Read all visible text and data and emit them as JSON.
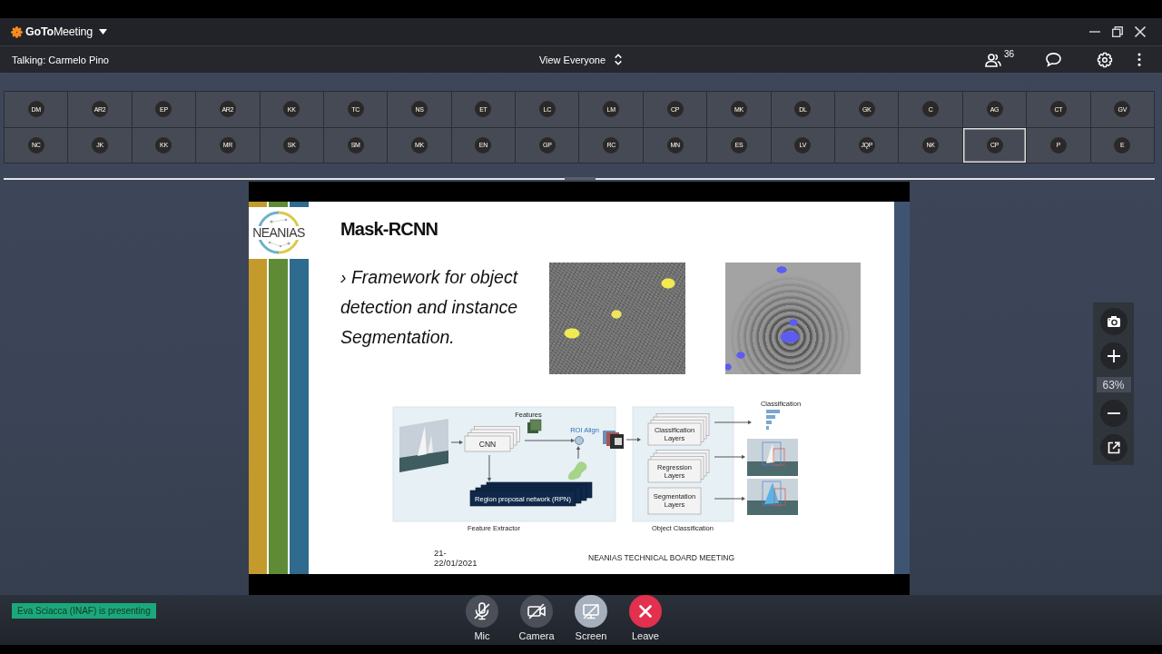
{
  "app": {
    "logo": "**GoTo**Meeting"
  },
  "meeting_bar": {
    "talking": "Talking: Carmelo Pino",
    "view": "View Everyone",
    "participant_count": "36"
  },
  "participants": [
    {
      "initials": "DM",
      "selected": false
    },
    {
      "initials": "AR2",
      "selected": false
    },
    {
      "initials": "EP",
      "selected": false
    },
    {
      "initials": "AR2",
      "selected": false
    },
    {
      "initials": "KK",
      "selected": false
    },
    {
      "initials": "TC",
      "selected": false
    },
    {
      "initials": "NS",
      "selected": false
    },
    {
      "initials": "ET",
      "selected": false
    },
    {
      "initials": "LC",
      "selected": false
    },
    {
      "initials": "LM",
      "selected": false
    },
    {
      "initials": "CP",
      "selected": false
    },
    {
      "initials": "MK",
      "selected": false
    },
    {
      "initials": "DL",
      "selected": false
    },
    {
      "initials": "GK",
      "selected": false
    },
    {
      "initials": "C",
      "selected": false
    },
    {
      "initials": "AG",
      "selected": false
    },
    {
      "initials": "CT",
      "selected": false
    },
    {
      "initials": "GV",
      "selected": false
    },
    {
      "initials": "NC",
      "selected": false
    },
    {
      "initials": "JK",
      "selected": false
    },
    {
      "initials": "KK",
      "selected": false
    },
    {
      "initials": "MR",
      "selected": false
    },
    {
      "initials": "SK",
      "selected": false
    },
    {
      "initials": "SM",
      "selected": false
    },
    {
      "initials": "MK",
      "selected": false
    },
    {
      "initials": "EN",
      "selected": false
    },
    {
      "initials": "GP",
      "selected": false
    },
    {
      "initials": "RC",
      "selected": false
    },
    {
      "initials": "MN",
      "selected": false
    },
    {
      "initials": "ES",
      "selected": false
    },
    {
      "initials": "LV",
      "selected": false
    },
    {
      "initials": "JQP",
      "selected": false
    },
    {
      "initials": "NK",
      "selected": false
    },
    {
      "initials": "CP",
      "selected": true
    },
    {
      "initials": "P",
      "selected": false
    },
    {
      "initials": "E",
      "selected": false
    }
  ],
  "slide": {
    "logo_text": "NEANIAS",
    "title": "Mask-RCNN",
    "bullet": "› Framework for object detection and instance Segmentation.",
    "diagram": {
      "features": "Features",
      "cnn": "CNN",
      "roi_align": "ROI Align",
      "rpn": "Region proposal network (RPN)",
      "feature_extractor": "Feature Extractor",
      "classification_layers": "Classification Layers",
      "regression_layers": "Regression Layers",
      "segmentation_layers": "Segmentation Layers",
      "object_classification": "Object Classification",
      "classification_output": "Classification"
    },
    "date": "21-\n22/01/2021",
    "footer": "NEANIAS TECHNICAL BOARD MEETING"
  },
  "zoom_panel": {
    "zoom": "63%"
  },
  "presenter_banner": "Eva Sciacca (INAF) is presenting",
  "controls": [
    {
      "kind": "mic",
      "label": "Mic",
      "off": true,
      "disabled": false
    },
    {
      "kind": "camera",
      "label": "Camera",
      "off": true,
      "disabled": false
    },
    {
      "kind": "screen",
      "label": "Screen",
      "off": true,
      "disabled": true
    },
    {
      "kind": "leave",
      "label": "Leave",
      "disabled": false
    }
  ]
}
